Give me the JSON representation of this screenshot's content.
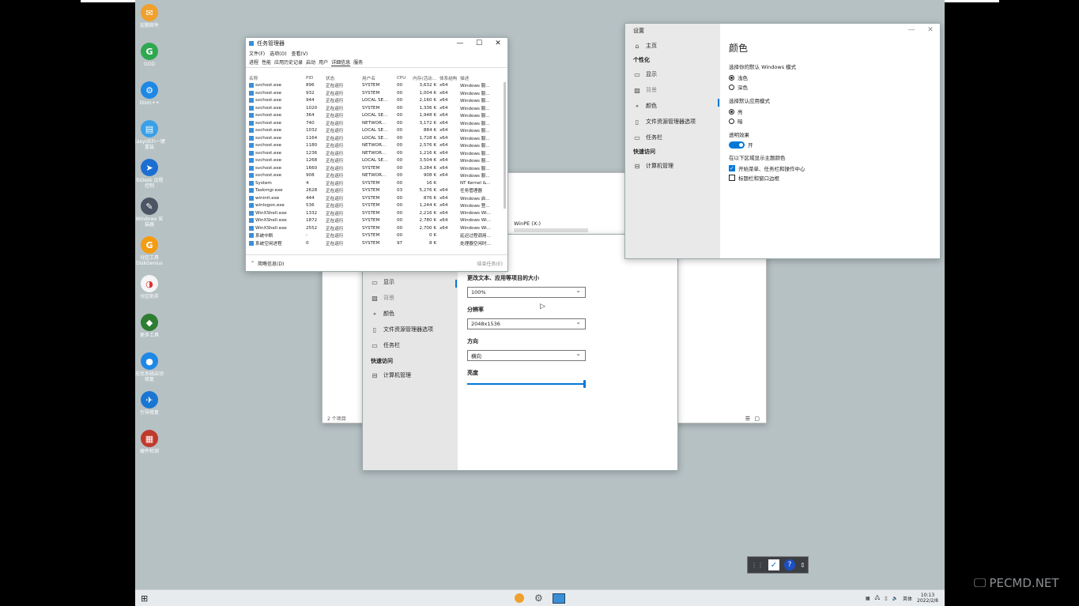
{
  "desktop_icons": [
    {
      "label": "宏鹏邮件",
      "color": "#f0a02c",
      "glyph": "✉"
    },
    {
      "label": "GOD",
      "color": "#2fa84f",
      "glyph": "G"
    },
    {
      "label": "Dism++",
      "color": "#1e88e5",
      "glyph": "⚙"
    },
    {
      "label": "EasyUEFI一键重装",
      "color": "#3aa0e8",
      "glyph": "▤"
    },
    {
      "label": "ToDesk 远程控制",
      "color": "#1c6fd1",
      "glyph": "➤"
    },
    {
      "label": "Windows 安装器",
      "color": "#4b5563",
      "glyph": "✎"
    },
    {
      "label": "分区工具 DiskGenius",
      "color": "#f39c12",
      "glyph": "G"
    },
    {
      "label": "分区助手",
      "color": "#f5f5f5",
      "glyph": "◑"
    },
    {
      "label": "更多工具",
      "color": "#2e7d32",
      "glyph": "◆"
    },
    {
      "label": "无忧系统启动修复",
      "color": "#1e88e5",
      "glyph": "●"
    },
    {
      "label": "引导修复",
      "color": "#1976d2",
      "glyph": "✈"
    },
    {
      "label": "硬件检测",
      "color": "#c0392b",
      "glyph": "▦"
    }
  ],
  "task_manager": {
    "title": "任务管理器",
    "menu": [
      "文件(F)",
      "选项(O)",
      "查看(V)"
    ],
    "tabs": [
      "进程",
      "性能",
      "应用历史记录",
      "启动",
      "用户",
      "详细信息",
      "服务"
    ],
    "active_tab": "详细信息",
    "columns": [
      "名称",
      "PID",
      "状态",
      "用户名",
      "CPU",
      "内存(活动...",
      "体系结构",
      "描述"
    ],
    "rows": [
      [
        "svchost.exe",
        "896",
        "正在运行",
        "SYSTEM",
        "00",
        "3,632 K",
        "x64",
        "Windows 服..."
      ],
      [
        "svchost.exe",
        "932",
        "正在运行",
        "SYSTEM",
        "00",
        "1,004 K",
        "x64",
        "Windows 服..."
      ],
      [
        "svchost.exe",
        "944",
        "正在运行",
        "LOCAL SE...",
        "00",
        "2,160 K",
        "x64",
        "Windows 服..."
      ],
      [
        "svchost.exe",
        "1020",
        "正在运行",
        "SYSTEM",
        "00",
        "1,336 K",
        "x64",
        "Windows 服..."
      ],
      [
        "svchost.exe",
        "364",
        "正在运行",
        "LOCAL SE...",
        "00",
        "1,948 K",
        "x64",
        "Windows 服..."
      ],
      [
        "svchost.exe",
        "740",
        "正在运行",
        "NETWOR...",
        "00",
        "3,172 K",
        "x64",
        "Windows 服..."
      ],
      [
        "svchost.exe",
        "1032",
        "正在运行",
        "LOCAL SE...",
        "00",
        "884 K",
        "x64",
        "Windows 服..."
      ],
      [
        "svchost.exe",
        "1164",
        "正在运行",
        "LOCAL SE...",
        "00",
        "1,728 K",
        "x64",
        "Windows 服..."
      ],
      [
        "svchost.exe",
        "1180",
        "正在运行",
        "NETWOR...",
        "00",
        "2,576 K",
        "x64",
        "Windows 服..."
      ],
      [
        "svchost.exe",
        "1236",
        "正在运行",
        "NETWOR...",
        "00",
        "1,216 K",
        "x64",
        "Windows 服..."
      ],
      [
        "svchost.exe",
        "1268",
        "正在运行",
        "LOCAL SE...",
        "00",
        "3,504 K",
        "x64",
        "Windows 服..."
      ],
      [
        "svchost.exe",
        "1660",
        "正在运行",
        "SYSTEM",
        "00",
        "3,284 K",
        "x64",
        "Windows 服..."
      ],
      [
        "svchost.exe",
        "908",
        "正在运行",
        "NETWOR...",
        "00",
        "908 K",
        "x64",
        "Windows 服..."
      ],
      [
        "System",
        "4",
        "正在运行",
        "SYSTEM",
        "00",
        "16 K",
        "",
        "NT Kernel &..."
      ],
      [
        "Taskmgr.exe",
        "2628",
        "正在运行",
        "SYSTEM",
        "03",
        "5,276 K",
        "x64",
        "任务管理器"
      ],
      [
        "wininit.exe",
        "444",
        "正在运行",
        "SYSTEM",
        "00",
        "876 K",
        "x64",
        "Windows 启..."
      ],
      [
        "winlogon.exe",
        "536",
        "正在运行",
        "SYSTEM",
        "00",
        "1,244 K",
        "x64",
        "Windows 登..."
      ],
      [
        "WinXShell.exe",
        "1332",
        "正在运行",
        "SYSTEM",
        "00",
        "2,216 K",
        "x64",
        "Windows Wi..."
      ],
      [
        "WinXShell.exe",
        "1872",
        "正在运行",
        "SYSTEM",
        "00",
        "2,780 K",
        "x64",
        "Windows Wi..."
      ],
      [
        "WinXShell.exe",
        "2552",
        "正在运行",
        "SYSTEM",
        "00",
        "2,700 K",
        "x64",
        "Windows Wi..."
      ],
      [
        "系统中断",
        "-",
        "正在运行",
        "SYSTEM",
        "00",
        "0 K",
        "",
        "延迟过程调用..."
      ],
      [
        "系统空闲进程",
        "0",
        "正在运行",
        "SYSTEM",
        "97",
        "8 K",
        "",
        "处理器空闲时..."
      ]
    ],
    "less_details": "简略信息(D)",
    "end_task": "结束任务(E)"
  },
  "settings_color": {
    "title": "设置",
    "nav": {
      "home": "主页",
      "section": "个性化",
      "items": [
        "显示",
        "背景",
        "颜色",
        "文件资源管理器选项",
        "任务栏"
      ],
      "quick": "快速访问",
      "quick_items": [
        "计算机管理"
      ]
    },
    "heading": "颜色",
    "windows_mode_label": "选择你的默认 Windows 模式",
    "windows_mode_options": [
      "浅色",
      "深色"
    ],
    "app_mode_label": "选择默认应用模式",
    "app_mode_options": [
      "亮",
      "暗"
    ],
    "transparency_label": "透明效果",
    "transparency_value": "开",
    "accent_label": "在以下区域显示主题颜色",
    "accent_options": [
      "开始菜单、任务栏和操作中心",
      "标题栏和窗口边框"
    ]
  },
  "explorer": {
    "drive_label": "WinPE (X:)",
    "status": "2 个项目"
  },
  "settings_display": {
    "nav_items": [
      "显示",
      "背景",
      "颜色",
      "文件资源管理器选项",
      "任务栏"
    ],
    "quick": "快速访问",
    "quick_items": [
      "计算机管理"
    ],
    "scale_label": "更改文本、应用等项目的大小",
    "scale_value": "100%",
    "resolution_label": "分辨率",
    "resolution_value": "2048x1536",
    "orientation_label": "方向",
    "orientation_value": "横向",
    "brightness_label": "亮度",
    "brightness_level": 1.0
  },
  "taskbar": {
    "ime": "英体",
    "time": "10:13",
    "date": "2022/2/8"
  },
  "watermark": "PECMD.NET",
  "colors": {
    "accent": "#0078d7",
    "desktop": "#b6c1c4"
  }
}
